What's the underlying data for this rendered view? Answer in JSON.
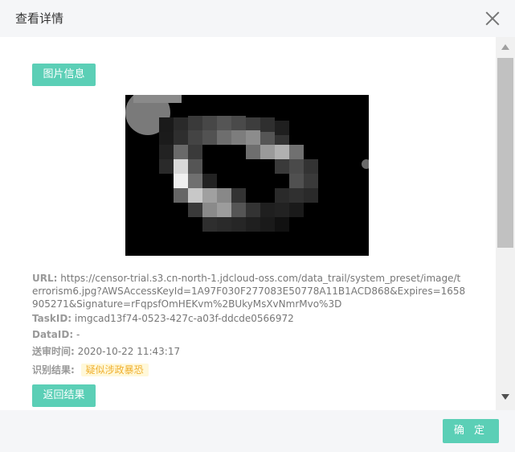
{
  "dialog": {
    "title": "查看详情"
  },
  "buttons": {
    "image_info": "图片信息",
    "return_result": "返回结果",
    "confirm": "确 定"
  },
  "details": {
    "url_label": "URL:",
    "url_value": "https://censor-trial.s3.cn-north-1.jdcloud-oss.com/data_trail/system_preset/image/terrorism6.jpg?AWSAccessKeyId=1A97F030F277083E50778A11B1ACD868&Expires=1658905271&Signature=rFqpsfOmHEKvm%2BUkyMsXvNmrMvo%3D",
    "taskid_label": "TaskID:",
    "taskid_value": "imgcad13f74-0523-427c-a03f-ddcde0566972",
    "dataid_label": "DataID:",
    "dataid_value": "-",
    "time_label": "送审时间:",
    "time_value": "2020-10-22 11:43:17",
    "result_label": "识别结果:",
    "result_value": "疑似涉政暴恐"
  },
  "colors": {
    "accent": "#5bcfb6",
    "badge_bg": "#fff8d9",
    "badge_text": "#f0b030"
  }
}
